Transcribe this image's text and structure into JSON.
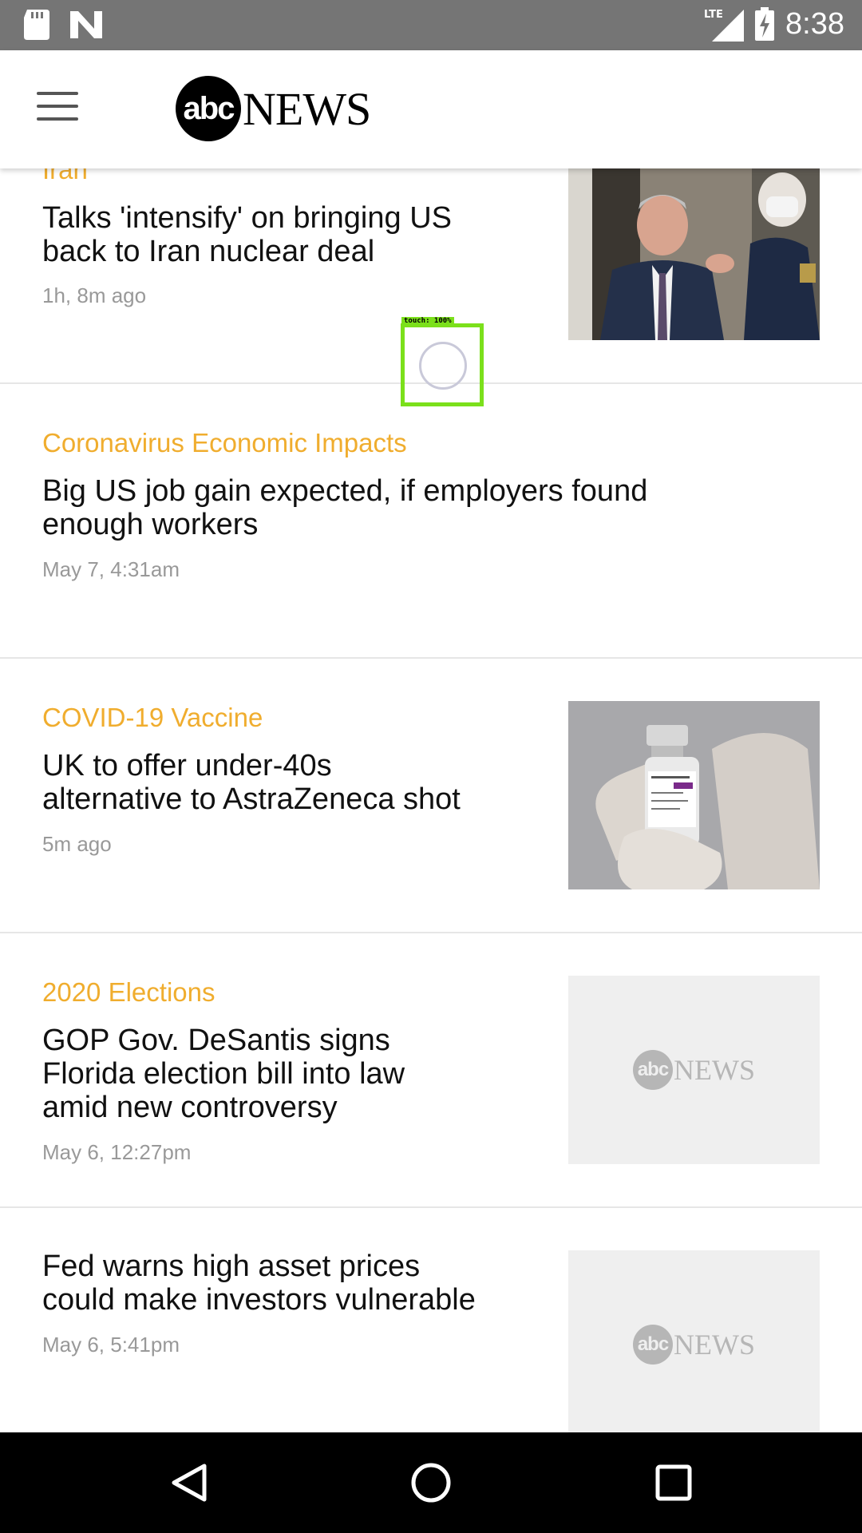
{
  "status_bar": {
    "time": "8:38",
    "network": "LTE",
    "icons": [
      "sd-card-icon",
      "n-notification-icon",
      "signal-icon",
      "battery-charging-icon"
    ]
  },
  "header": {
    "menu_icon": "hamburger-menu-icon",
    "logo_abc": "abc",
    "logo_news": "NEWS"
  },
  "articles": [
    {
      "category": "Iran",
      "headline": "Talks 'intensify' on bringing US back to Iran nuclear deal",
      "headline_lines": [
        "Talks 'intensify' on bringing US",
        "back to Iran nuclear deal"
      ],
      "time": "1h, 8m ago",
      "thumbnail": "photo"
    },
    {
      "category": "Coronavirus Economic Impacts",
      "headline_lines": [
        "Big US job gain expected, if employers found",
        "enough workers"
      ],
      "time": "May 7, 4:31am",
      "thumbnail": "none"
    },
    {
      "category": "COVID-19 Vaccine",
      "headline_lines": [
        "UK to offer under-40s",
        "alternative to AstraZeneca shot"
      ],
      "time": "5m ago",
      "thumbnail": "photo"
    },
    {
      "category": "2020 Elections",
      "headline_lines": [
        "GOP Gov. DeSantis signs",
        "Florida election bill into law",
        "amid new controversy"
      ],
      "time": "May 6, 12:27pm",
      "thumbnail": "placeholder",
      "placeholder_abc": "abc",
      "placeholder_news": "NEWS"
    },
    {
      "category": "",
      "headline_lines": [
        "Fed warns high asset prices",
        "could make investors vulnerable"
      ],
      "time": "May 6, 5:41pm",
      "thumbnail": "placeholder",
      "placeholder_abc": "abc",
      "placeholder_news": "NEWS"
    }
  ],
  "touch_overlay": {
    "label": "touch: 100%"
  },
  "nav_bar": {
    "buttons": [
      "back-icon",
      "home-icon",
      "recents-icon"
    ]
  },
  "colors": {
    "category": "#f0ad2e",
    "status_bar": "#757575",
    "touch_box": "#7be01b"
  }
}
